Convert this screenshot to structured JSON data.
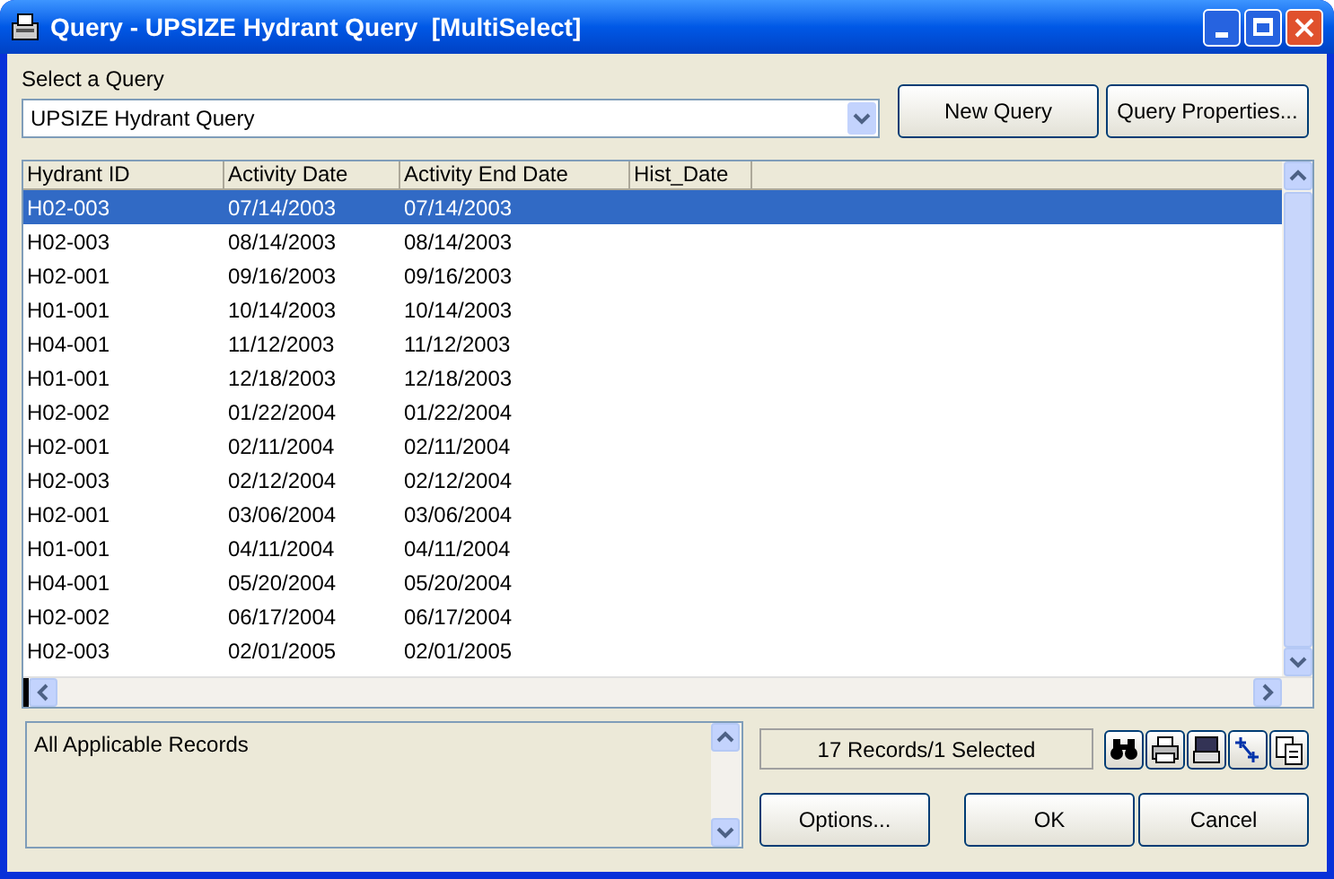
{
  "window": {
    "title": "Query - UPSIZE Hydrant Query  [MultiSelect]"
  },
  "query_select": {
    "label": "Select a Query",
    "value": "UPSIZE Hydrant Query"
  },
  "top_buttons": [
    "New Query",
    "Query Properties..."
  ],
  "table": {
    "columns": [
      "Hydrant ID",
      "Activity Date",
      "Activity End Date",
      "Hist_Date"
    ],
    "rows": [
      {
        "cells": [
          "H02-003",
          "07/14/2003",
          "07/14/2003"
        ],
        "selected": true
      },
      {
        "cells": [
          "H02-003",
          "08/14/2003",
          "08/14/2003"
        ],
        "selected": false
      },
      {
        "cells": [
          "H02-001",
          "09/16/2003",
          "09/16/2003"
        ],
        "selected": false
      },
      {
        "cells": [
          "H01-001",
          "10/14/2003",
          "10/14/2003"
        ],
        "selected": false
      },
      {
        "cells": [
          "H04-001",
          "11/12/2003",
          "11/12/2003"
        ],
        "selected": false
      },
      {
        "cells": [
          "H01-001",
          "12/18/2003",
          "12/18/2003"
        ],
        "selected": false
      },
      {
        "cells": [
          "H02-002",
          "01/22/2004",
          "01/22/2004"
        ],
        "selected": false
      },
      {
        "cells": [
          "H02-001",
          "02/11/2004",
          "02/11/2004"
        ],
        "selected": false
      },
      {
        "cells": [
          "H02-003",
          "02/12/2004",
          "02/12/2004"
        ],
        "selected": false
      },
      {
        "cells": [
          "H02-001",
          "03/06/2004",
          "03/06/2004"
        ],
        "selected": false
      },
      {
        "cells": [
          "H01-001",
          "04/11/2004",
          "04/11/2004"
        ],
        "selected": false
      },
      {
        "cells": [
          "H04-001",
          "05/20/2004",
          "05/20/2004"
        ],
        "selected": false
      },
      {
        "cells": [
          "H02-002",
          "06/17/2004",
          "06/17/2004"
        ],
        "selected": false
      },
      {
        "cells": [
          "H02-003",
          "02/01/2005",
          "02/01/2005"
        ],
        "selected": false
      }
    ]
  },
  "description": "All Applicable Records",
  "status": "17 Records/1 Selected",
  "tools": [
    {
      "kind": "find"
    },
    {
      "kind": "print"
    },
    {
      "kind": "export"
    },
    {
      "kind": "map"
    },
    {
      "kind": "copy"
    }
  ],
  "bottom_buttons": [
    "Options...",
    "OK",
    "Cancel"
  ]
}
